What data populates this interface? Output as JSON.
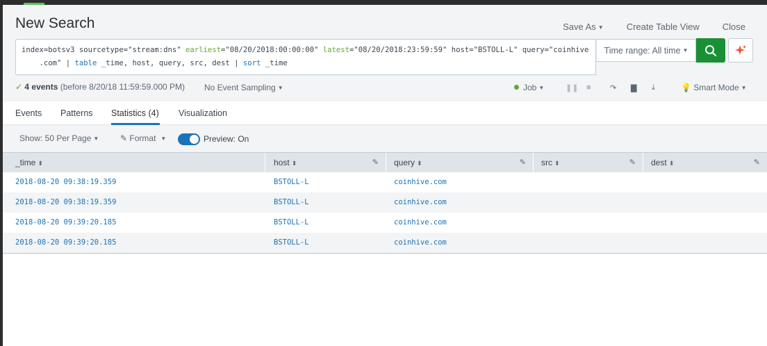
{
  "header": {
    "title": "New Search",
    "save_as": "Save As",
    "create_table_view": "Create Table View",
    "close": "Close"
  },
  "search": {
    "q_part1": "index=botsv3 sourcetype=\"stream:dns\" ",
    "q_earliest_kw": "earliest",
    "q_earliest_val": "=\"08/20/2018:00:00:00\" ",
    "q_latest_kw": "latest",
    "q_latest_val": "=\"08/20/2018:23:59:59\" host=\"BSTOLL-L\" query=\"coinhive",
    "q_line2_indent": "    .com\" | ",
    "q_table_kw": "table",
    "q_table_fields": " _time, host, query, src, dest | ",
    "q_sort_kw": "sort",
    "q_sort_field": " _time",
    "time_range": "Time range: All time"
  },
  "status": {
    "events_count": "4 events",
    "events_sub": "(before 8/20/18 11:59:59.000 PM)",
    "sampling": "No Event Sampling",
    "job": "Job",
    "smart_mode": "Smart Mode"
  },
  "tabs": [
    {
      "label": "Events"
    },
    {
      "label": "Patterns"
    },
    {
      "label": "Statistics (4)"
    },
    {
      "label": "Visualization"
    }
  ],
  "toolbar": {
    "show": "Show: 50 Per Page",
    "format": "Format",
    "preview": "Preview: On"
  },
  "table": {
    "columns": [
      "_time",
      "host",
      "query",
      "src",
      "dest"
    ],
    "rows": [
      {
        "time": "2018-08-20 09:38:19.359",
        "host": "BSTOLL-L",
        "query": "coinhive.com",
        "src": "",
        "dest": ""
      },
      {
        "time": "2018-08-20 09:38:19.359",
        "host": "BSTOLL-L",
        "query": "coinhive.com",
        "src": "",
        "dest": ""
      },
      {
        "time": "2018-08-20 09:39:20.185",
        "host": "BSTOLL-L",
        "query": "coinhive.com",
        "src": "",
        "dest": ""
      },
      {
        "time": "2018-08-20 09:39:20.185",
        "host": "BSTOLL-L",
        "query": "coinhive.com",
        "src": "",
        "dest": ""
      }
    ]
  },
  "colors": {
    "accent": "#1a73b9",
    "search_button": "#1a9035",
    "success": "#65a637"
  }
}
